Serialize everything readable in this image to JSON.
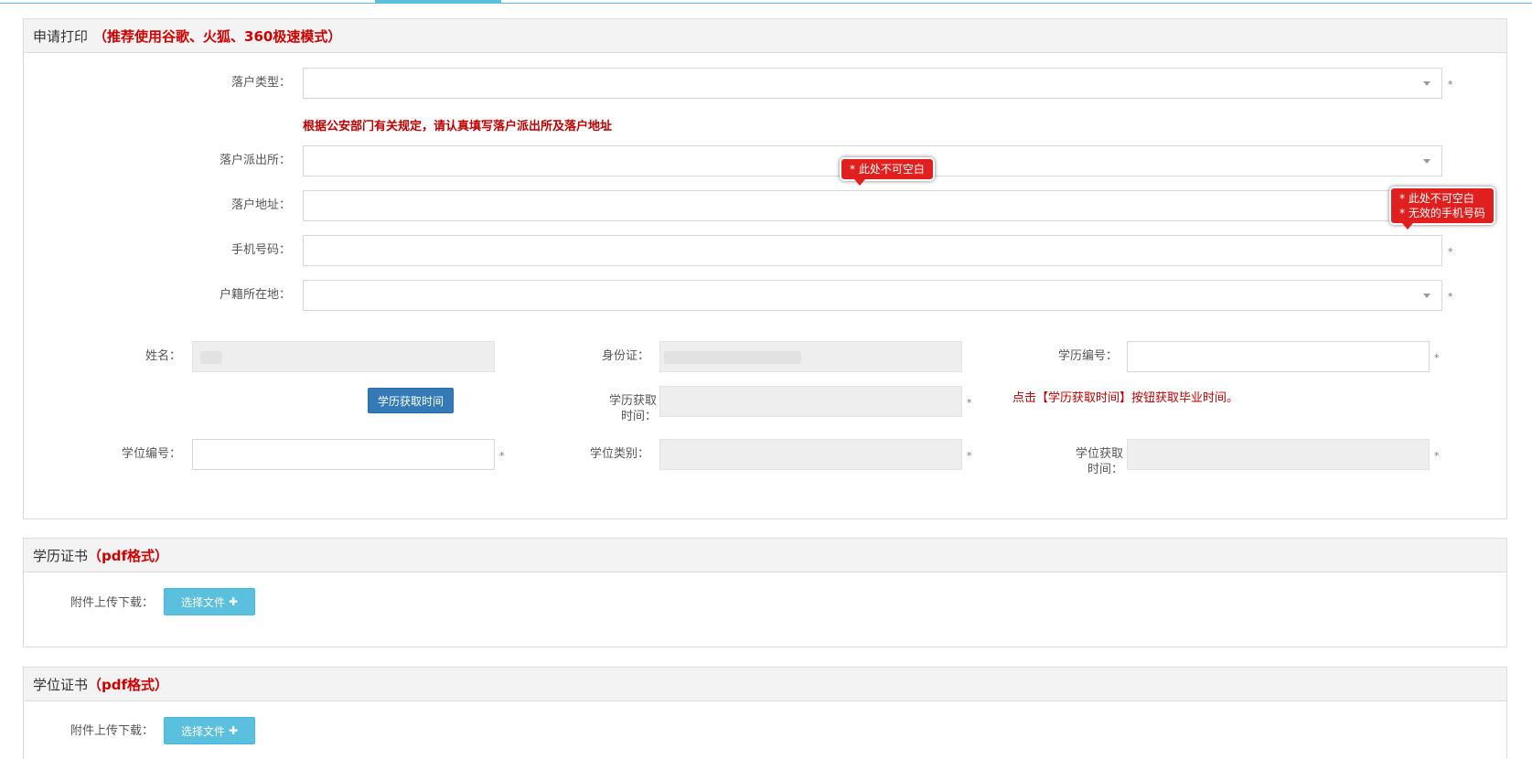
{
  "apply": {
    "title": "申请打印",
    "note": "（推荐使用谷歌、火狐、360极速模式）",
    "settle_type_label": "落户类型：",
    "police_notice": "根据公安部门有关规定，请认真填写落户派出所及落户地址",
    "police_station_label": "落户派出所：",
    "address_label": "落户地址：",
    "phone_label": "手机号码：",
    "household_label": "户籍所在地：",
    "name_label": "姓名：",
    "id_label": "身份证：",
    "edu_no_label": "学历编号：",
    "get_edu_time_button": "学历获取时间",
    "edu_time_label_1": "学历获取",
    "edu_time_label_2": "时间：",
    "edu_time_hint": "点击【学历获取时间】按钮获取毕业时间。",
    "degree_no_label": "学位编号：",
    "degree_type_label": "学位类别：",
    "degree_time_label_1": "学位获取",
    "degree_time_label_2": "时间：",
    "required_mark": "*"
  },
  "tooltips": {
    "address_error": "* 此处不可空白",
    "phone_error_1": "* 此处不可空白",
    "phone_error_2": "* 无效的手机号码"
  },
  "edu_cert": {
    "title": "学历证书",
    "note": "（pdf格式）",
    "attach_label": "附件上传下载：",
    "choose_file": "选择文件"
  },
  "degree_cert": {
    "title": "学位证书",
    "note": "（pdf格式）",
    "attach_label": "附件上传下载：",
    "choose_file": "选择文件"
  },
  "icons": {
    "choose_file": "plus-icon",
    "select": "caret-down-icon"
  },
  "colors": {
    "accent": "#5bc0de",
    "primary": "#337ab7",
    "error": "#e0201e",
    "hint": "#c00000"
  }
}
